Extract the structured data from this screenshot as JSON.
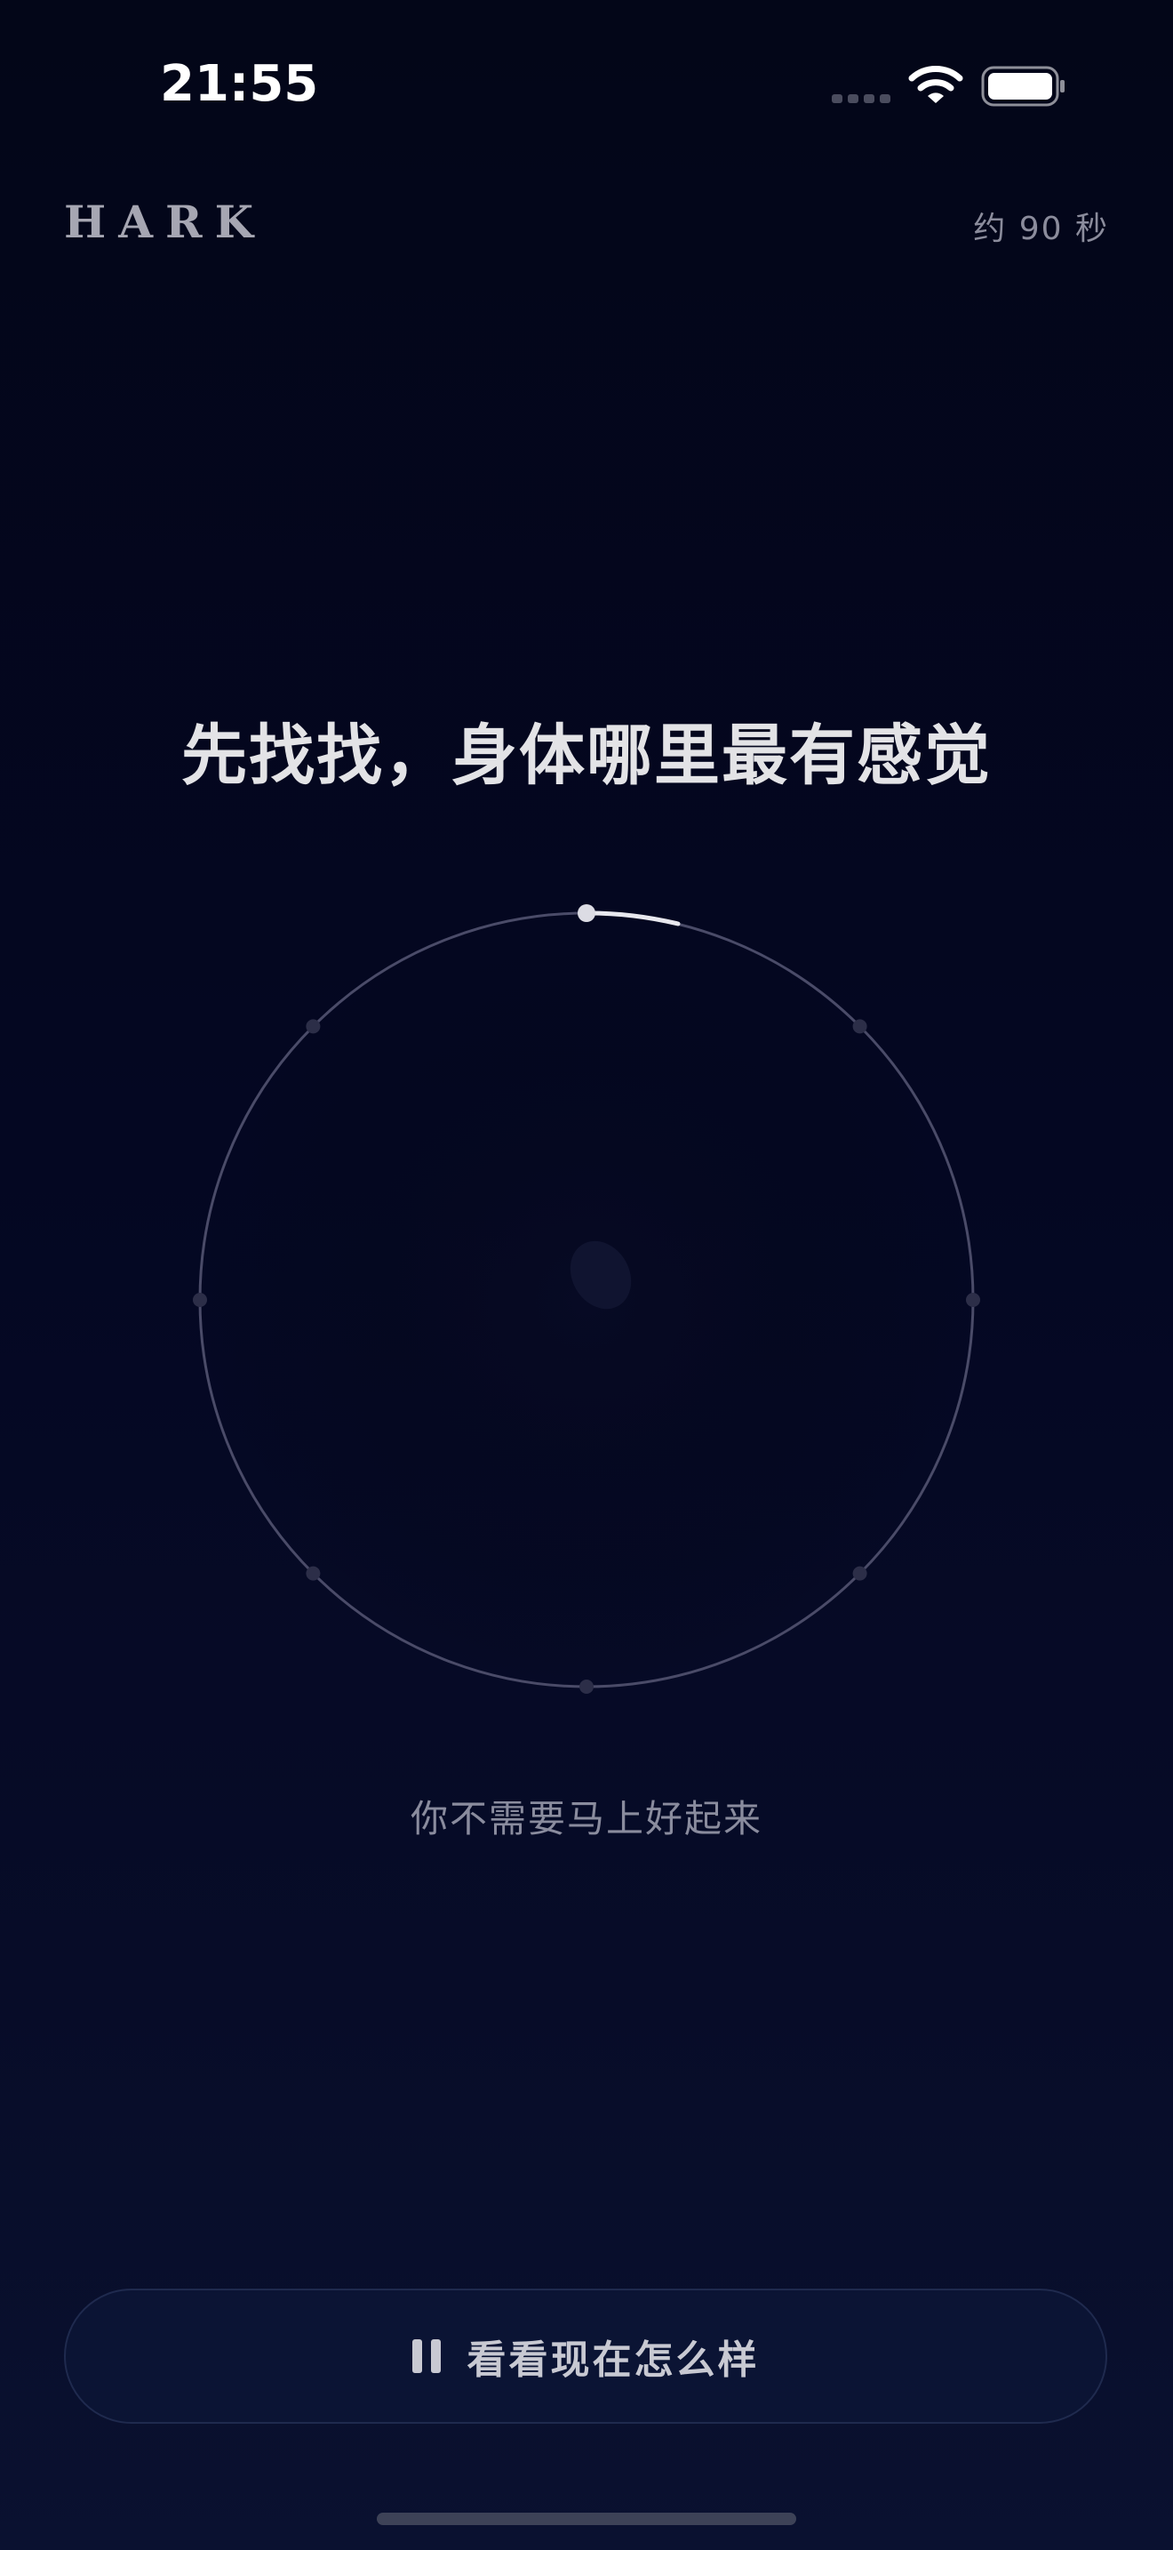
{
  "status_bar": {
    "time": "21:55",
    "icons": [
      "cell-signal-icon",
      "wifi-icon",
      "battery-icon"
    ]
  },
  "header": {
    "brand": "HARK",
    "duration": "约 90 秒"
  },
  "exercise": {
    "prompt": "先找找，身体哪里最有感觉",
    "subtitle": "你不需要马上好起来",
    "ring_marker_count": 8
  },
  "footer": {
    "button_icon": "pause-icon",
    "button_label": "看看现在怎么样"
  },
  "colors": {
    "background": "#030618",
    "ring_stroke": "#4a4b68",
    "progress_arc": "#e8e8ee",
    "button_bg": "#0b1434",
    "button_border": "#1f2a4e",
    "text_primary": "#e3e3e6",
    "text_muted": "#8a8c9e"
  }
}
